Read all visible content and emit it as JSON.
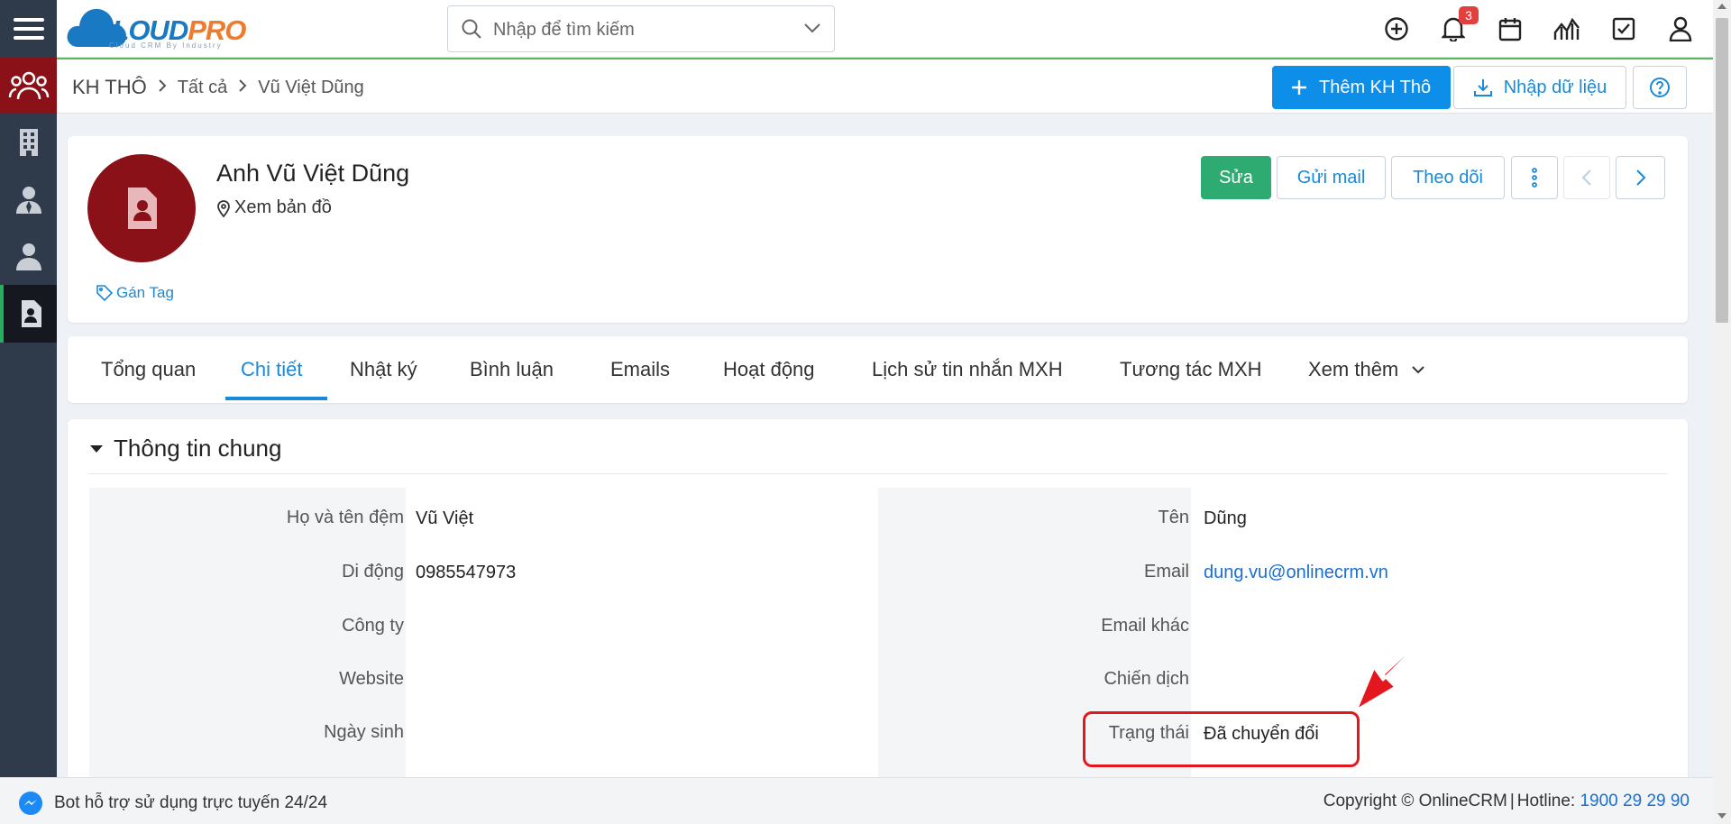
{
  "logo": {
    "brand_cloud": "CLOUD",
    "brand_pro": "PRO",
    "tagline": "Cloud CRM By Industry"
  },
  "search": {
    "placeholder": "Nhập để tìm kiếm"
  },
  "topbar": {
    "notification_count": "3",
    "icons": [
      "plus-circle-icon",
      "bell-icon",
      "calendar-icon",
      "chart-icon",
      "checkbox-icon",
      "user-icon"
    ]
  },
  "sidebar": {
    "items": [
      "menu-icon",
      "group-icon",
      "building-icon",
      "contact-icon",
      "person-icon",
      "lead-icon"
    ],
    "active": "lead-icon"
  },
  "breadcrumb": {
    "root": "KH THÔ",
    "level1": "Tất cả",
    "level2": "Vũ Việt Dũng"
  },
  "header_actions": {
    "add_label": "Thêm KH Thô",
    "import_label": "Nhập dữ liệu"
  },
  "profile": {
    "name": "Anh Vũ Việt Dũng",
    "map_label": "Xem bản đồ",
    "tag_label": "Gán Tag",
    "edit_label": "Sửa",
    "mail_label": "Gửi mail",
    "follow_label": "Theo dõi"
  },
  "tabs": [
    {
      "label": "Tổng quan"
    },
    {
      "label": "Chi tiết"
    },
    {
      "label": "Nhật ký"
    },
    {
      "label": "Bình luận"
    },
    {
      "label": "Emails"
    },
    {
      "label": "Hoạt động"
    },
    {
      "label": "Lịch sử tin nhắn MXH"
    },
    {
      "label": "Tương tác MXH"
    },
    {
      "label": "Xem thêm"
    }
  ],
  "active_tab": "Chi tiết",
  "section": {
    "title": "Thông tin chung",
    "left": [
      {
        "label": "Họ và tên đệm",
        "value": "Vũ Việt"
      },
      {
        "label": "Di động",
        "value": "0985547973"
      },
      {
        "label": "Công ty",
        "value": ""
      },
      {
        "label": "Website",
        "value": ""
      },
      {
        "label": "Ngày sinh",
        "value": ""
      }
    ],
    "right": [
      {
        "label": "Tên",
        "value": "Dũng"
      },
      {
        "label": "Email",
        "value": "dung.vu@onlinecrm.vn"
      },
      {
        "label": "Email khác",
        "value": ""
      },
      {
        "label": "Chiến dịch",
        "value": ""
      },
      {
        "label": "Trạng thái",
        "value": "Đã chuyển đổi"
      }
    ]
  },
  "footer": {
    "bot_label": "Bot hỗ trợ sử dụng trực tuyến 24/24",
    "copyright": "Copyright © OnlineCRM",
    "hotline_label": "Hotline:",
    "hotline_number": "1900 29 29 90"
  },
  "colors": {
    "primary": "#0d8ee8",
    "success": "#2eab71",
    "brand_red": "#8b1118",
    "sidebar": "#2f3a4b",
    "annotation": "#e3171d"
  }
}
